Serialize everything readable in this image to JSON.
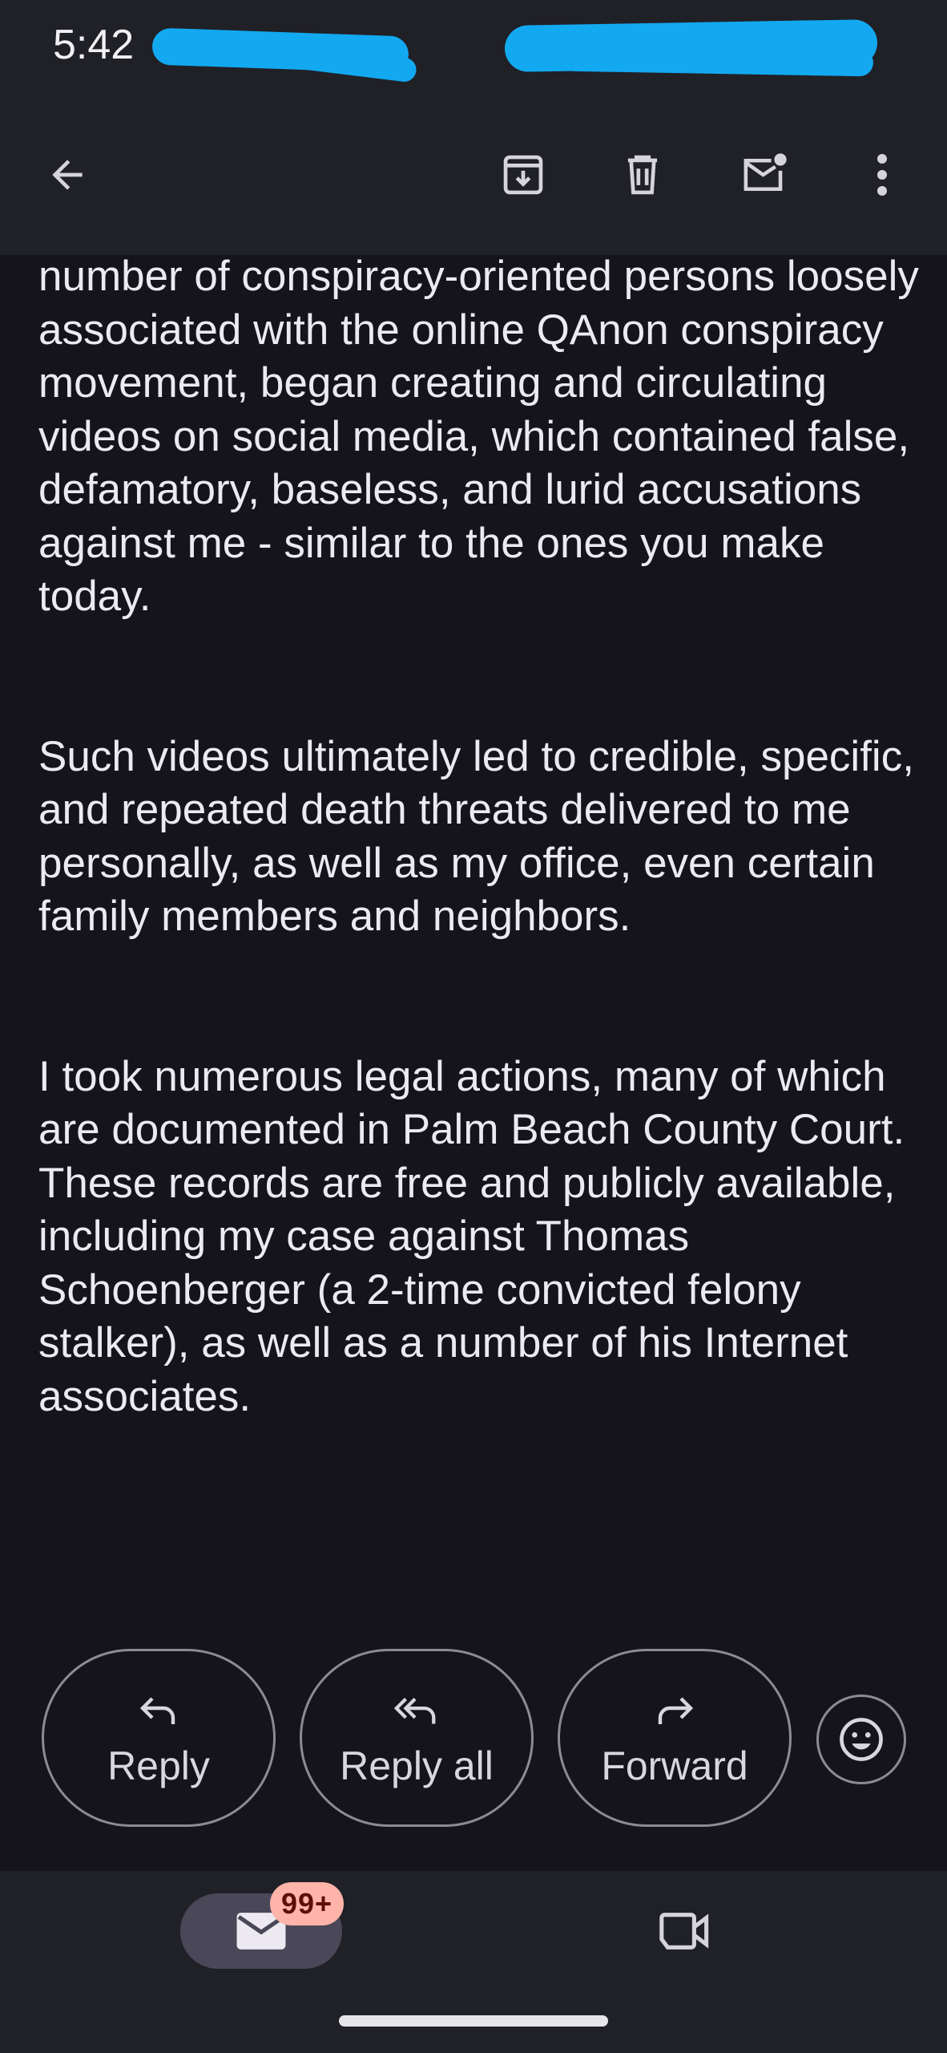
{
  "status_bar": {
    "time": "5:42"
  },
  "toolbar": {
    "back_icon": "arrow-left-icon",
    "archive_icon": "archive-icon",
    "delete_icon": "trash-icon",
    "mark_unread_icon": "mail-unread-icon",
    "more_icon": "more-vert-icon"
  },
  "email": {
    "paragraphs": [
      "number of conspiracy-oriented persons loosely associated with the online QAnon conspiracy movement, began creating and circulating videos on social media, which contained false, defamatory, baseless, and lurid accusations against me - similar to the ones you make today.",
      "Such videos ultimately led to credible, specific, and repeated death threats delivered to me personally, as well as my office, even certain family members and neighbors.",
      "I took numerous legal actions, many of which are documented in Palm Beach County Court.  These records are free and publicly available, including my case against Thomas Schoenberger (a 2-time convicted felony stalker), as well as a number of his Internet associates."
    ]
  },
  "actions": {
    "reply_label": "Reply",
    "reply_all_label": "Reply all",
    "forward_label": "Forward",
    "emoji_icon": "smiley-icon"
  },
  "bottom_nav": {
    "mail_badge": "99+",
    "mail_icon": "mail-icon",
    "meet_icon": "video-camera-icon"
  },
  "colors": {
    "background": "#14141a",
    "bar_background": "#202027",
    "text": "#eceaf0",
    "redaction": "#12a9f0",
    "badge_background": "#ffb4a9",
    "pill_background": "#4a4858"
  }
}
